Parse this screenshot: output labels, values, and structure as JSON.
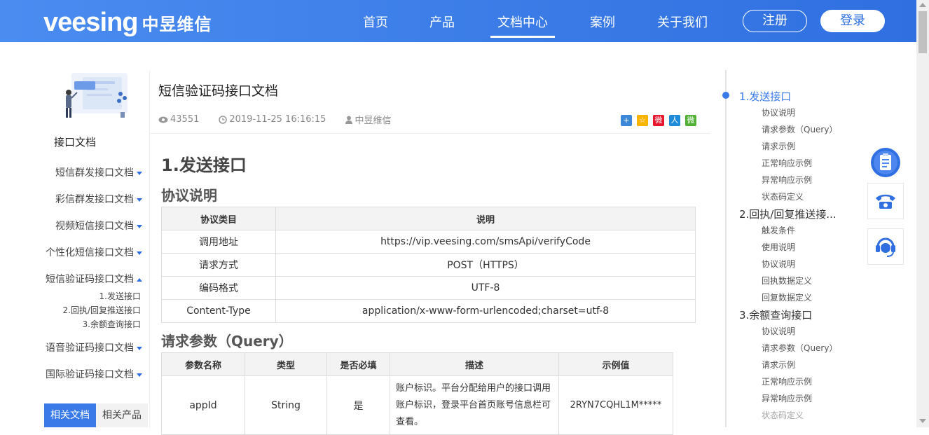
{
  "header": {
    "logo_word": "veesing",
    "logo_cn": "中昱维信",
    "nav": [
      "首页",
      "产品",
      "文档中心",
      "案例",
      "关于我们"
    ],
    "active_nav": "文档中心",
    "register_label": "注册",
    "login_label": "登录",
    "accent": "#2f6fe0"
  },
  "sidebar": {
    "title": "接口文档",
    "items": [
      {
        "label": "短信群发接口文档"
      },
      {
        "label": "彩信群发接口文档"
      },
      {
        "label": "视频短信接口文档"
      },
      {
        "label": "个性化短信接口文档"
      },
      {
        "label": "短信验证码接口文档"
      },
      {
        "label": "语音验证码接口文档"
      },
      {
        "label": "国际验证码接口文档"
      }
    ],
    "subitems": [
      "1.发送接口",
      "2.回执/回复推送接口",
      "3.余额查询接口"
    ],
    "tabs": [
      "相关文档",
      "相关产品"
    ]
  },
  "article": {
    "title": "短信验证码接口文档",
    "views": "43551",
    "date": "2019-11-25 16:16:15",
    "author": "中昱维信",
    "share_icons": [
      "qzone-icon",
      "tqq-icon",
      "weibo-icon",
      "renren-icon",
      "wechat-icon"
    ],
    "h1": "1.发送接口",
    "section1": "协议说明",
    "table1": {
      "headers": [
        "协议类目",
        "说明"
      ],
      "rows": [
        [
          "调用地址",
          "https://vip.veesing.com/smsApi/verifyCode"
        ],
        [
          "请求方式",
          "POST（HTTPS）"
        ],
        [
          "编码格式",
          "UTF-8"
        ],
        [
          "Content-Type",
          "application/x-www-form-urlencoded;charset=utf-8"
        ]
      ]
    },
    "section2": "请求参数（Query）",
    "table2": {
      "headers": [
        "参数名称",
        "类型",
        "是否必填",
        "描述",
        "示例值"
      ],
      "rows": [
        [
          "appId",
          "String",
          "是",
          "账户标识。平台分配给用户的接口调用账户标识，登录平台首页账号信息栏可查看。",
          "2RYN7CQHL1M*****"
        ]
      ]
    }
  },
  "toc": {
    "groups": [
      {
        "title": "1.发送接口",
        "items": [
          "协议说明",
          "请求参数（Query）",
          "请求示例",
          "正常响应示例",
          "异常响应示例",
          "状态码定义"
        ]
      },
      {
        "title": "2.回执/回复推送接...",
        "items": [
          "触发条件",
          "使用说明",
          "协议说明",
          "回执数据定义",
          "回复数据定义"
        ]
      },
      {
        "title": "3.余额查询接口",
        "items": [
          "协议说明",
          "请求参数（Query）",
          "请求示例",
          "正常响应示例",
          "异常响应示例",
          "状态码定义"
        ]
      }
    ]
  },
  "float_buttons": [
    "clipboard-icon",
    "phone-icon",
    "customer-service-icon"
  ]
}
